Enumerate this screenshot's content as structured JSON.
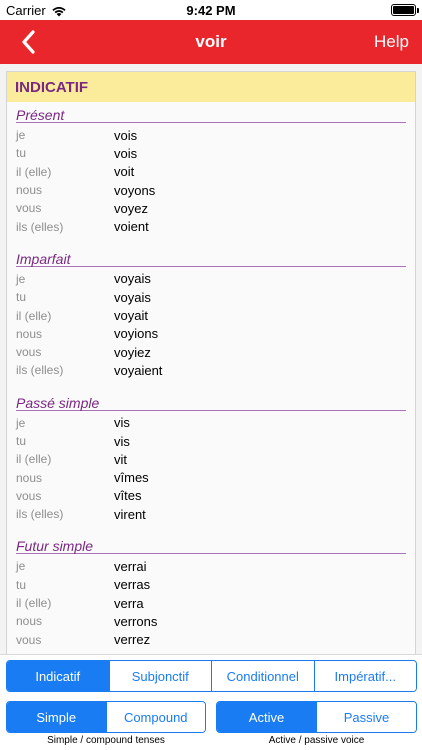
{
  "status": {
    "carrier": "Carrier",
    "time": "9:42 PM",
    "battery_level": 1.0
  },
  "nav": {
    "title": "voir",
    "help_label": "Help"
  },
  "mood": "INDICATIF",
  "tenses": [
    {
      "name": "Présent",
      "rows": [
        {
          "pronoun": "je",
          "form": "vois"
        },
        {
          "pronoun": "tu",
          "form": "vois"
        },
        {
          "pronoun": "il (elle)",
          "form": "voit"
        },
        {
          "pronoun": "nous",
          "form": "voyons"
        },
        {
          "pronoun": "vous",
          "form": "voyez"
        },
        {
          "pronoun": "ils (elles)",
          "form": "voient"
        }
      ]
    },
    {
      "name": "Imparfait",
      "rows": [
        {
          "pronoun": "je",
          "form": "voyais"
        },
        {
          "pronoun": "tu",
          "form": "voyais"
        },
        {
          "pronoun": "il (elle)",
          "form": "voyait"
        },
        {
          "pronoun": "nous",
          "form": "voyions"
        },
        {
          "pronoun": "vous",
          "form": "voyiez"
        },
        {
          "pronoun": "ils (elles)",
          "form": "voyaient"
        }
      ]
    },
    {
      "name": "Passé simple",
      "rows": [
        {
          "pronoun": "je",
          "form": "vis"
        },
        {
          "pronoun": "tu",
          "form": "vis"
        },
        {
          "pronoun": "il (elle)",
          "form": "vit"
        },
        {
          "pronoun": "nous",
          "form": "vîmes"
        },
        {
          "pronoun": "vous",
          "form": "vîtes"
        },
        {
          "pronoun": "ils (elles)",
          "form": "virent"
        }
      ]
    },
    {
      "name": "Futur simple",
      "rows": [
        {
          "pronoun": "je",
          "form": "verrai"
        },
        {
          "pronoun": "tu",
          "form": "verras"
        },
        {
          "pronoun": "il (elle)",
          "form": "verra"
        },
        {
          "pronoun": "nous",
          "form": "verrons"
        },
        {
          "pronoun": "vous",
          "form": "verrez"
        }
      ]
    }
  ],
  "mood_tabs": {
    "options": [
      "Indicatif",
      "Subjonctif",
      "Conditionnel",
      "Impératif..."
    ],
    "selected": "Indicatif"
  },
  "tense_type": {
    "options": [
      "Simple",
      "Compound"
    ],
    "selected": "Simple",
    "caption": "Simple / compound tenses"
  },
  "voice": {
    "options": [
      "Active",
      "Passive"
    ],
    "selected": "Active",
    "caption": "Active / passive voice"
  },
  "colors": {
    "nav_red": "#e8262c",
    "mood_header_bg": "#fbec9c",
    "purple": "#7a2882",
    "segment_blue": "#1a7cf2"
  }
}
